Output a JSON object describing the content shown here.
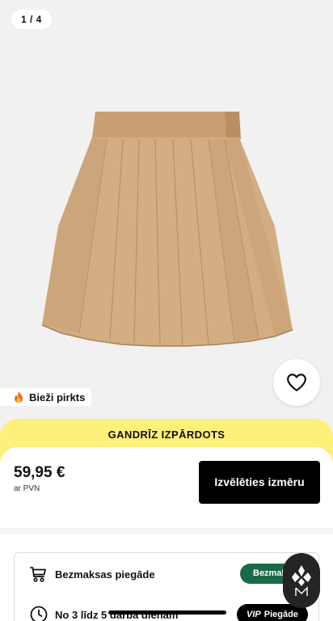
{
  "gallery": {
    "counter": "1 / 4",
    "image_alt": "beige pleated mini skirt"
  },
  "badge": {
    "icon": "fire-icon",
    "label": "Bieži pirkts"
  },
  "stock_banner": "GANDRĪZ IZPĀRDOTS",
  "purchase": {
    "price": "59,95 €",
    "vat_note": "ar PVN",
    "select_size_label": "Izvēlēties izmēru"
  },
  "delivery": {
    "free_shipping": {
      "icon": "cart-icon",
      "label": "Bezmaksas piegāde",
      "pill": "Bezmaksas"
    },
    "days": {
      "icon": "clock-icon",
      "label": "No 3 līdz 5 darba dienām",
      "pill_prefix": "VIP",
      "pill": "Piegāde"
    }
  },
  "colors": {
    "banner": "#fdf07b",
    "button": "#000000",
    "pill_green": "#1a6a4a",
    "skirt": "#d2aa7f"
  }
}
